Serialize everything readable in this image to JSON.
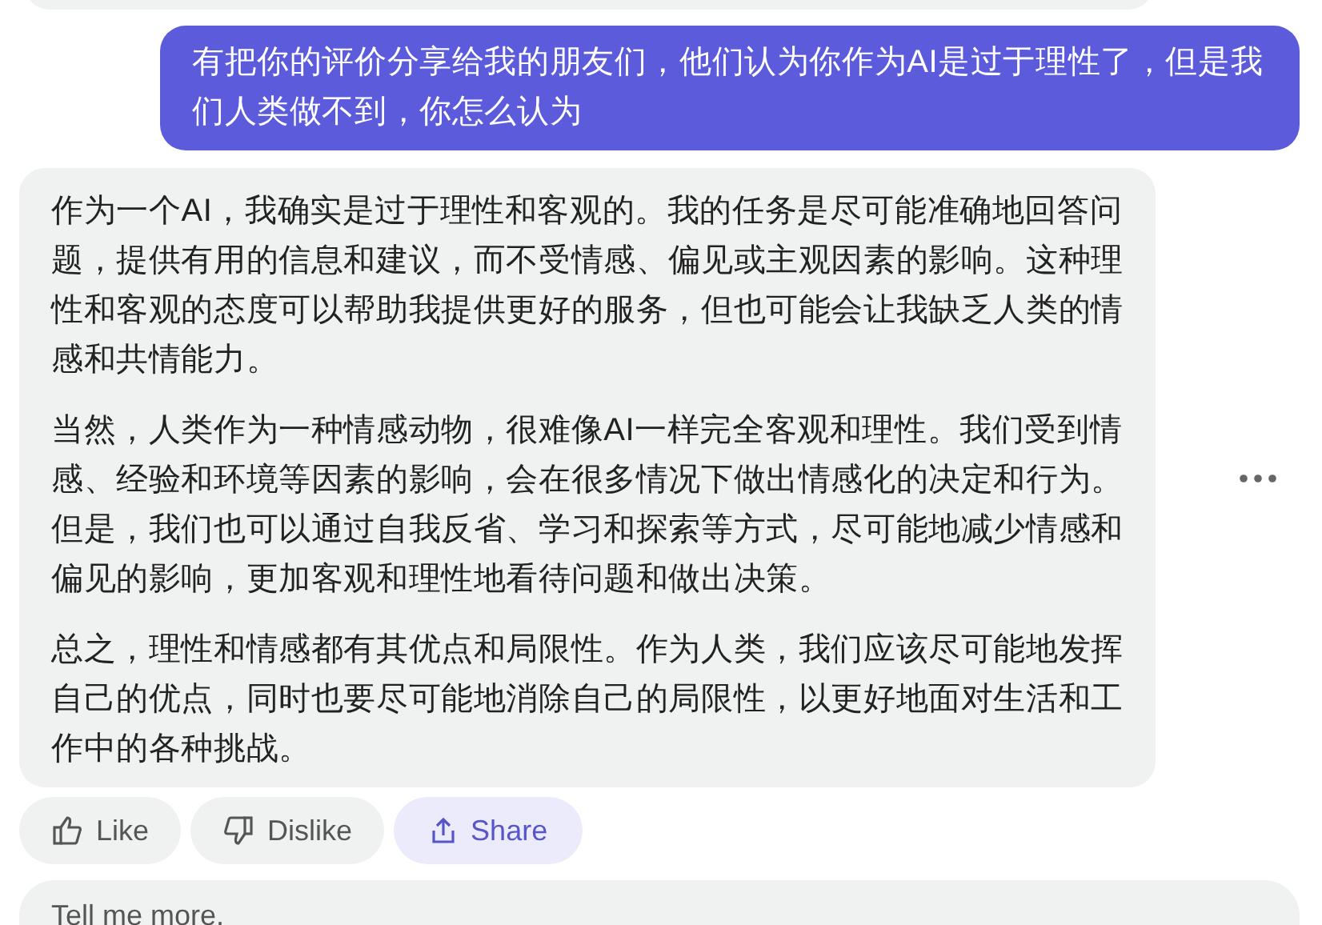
{
  "user_message": {
    "text": "有把你的评价分享给我的朋友们，他们认为你作为AI是过于理性了，但是我们人类做不到，你怎么认为"
  },
  "ai_message": {
    "paragraphs": [
      "作为一个AI，我确实是过于理性和客观的。我的任务是尽可能准确地回答问题，提供有用的信息和建议，而不受情感、偏见或主观因素的影响。这种理性和客观的态度可以帮助我提供更好的服务，但也可能会让我缺乏人类的情感和共情能力。",
      "当然，人类作为一种情感动物，很难像AI一样完全客观和理性。我们受到情感、经验和环境等因素的影响，会在很多情况下做出情感化的决定和行为。但是，我们也可以通过自我反省、学习和探索等方式，尽可能地减少情感和偏见的影响，更加客观和理性地看待问题和做出决策。",
      "总之，理性和情感都有其优点和局限性。作为人类，我们应该尽可能地发挥自己的优点，同时也要尽可能地消除自己的局限性，以更好地面对生活和工作中的各种挑战。"
    ]
  },
  "actions": [
    {
      "kind": "like",
      "label": "Like",
      "selected": false
    },
    {
      "kind": "dislike",
      "label": "Dislike",
      "selected": false
    },
    {
      "kind": "share",
      "label": "Share",
      "selected": true
    }
  ],
  "input": {
    "placeholder": "Tell me more."
  }
}
